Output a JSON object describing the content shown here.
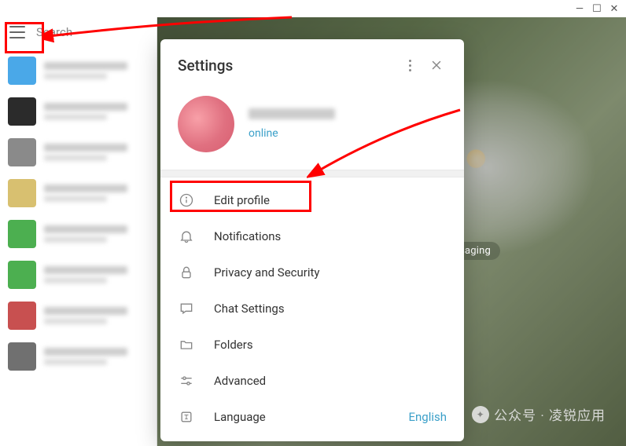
{
  "window": {
    "minimize": "—",
    "maximize": "☐",
    "close": "✕"
  },
  "sidebar": {
    "search_placeholder": "Search",
    "chats": [
      {
        "avatar_color": "#4aa8e8"
      },
      {
        "avatar_color": "#2b2b2b"
      },
      {
        "avatar_color": "#8a8a8a"
      },
      {
        "avatar_color": "#d8c070"
      },
      {
        "avatar_color": "#4caf50"
      },
      {
        "avatar_color": "#4caf50"
      },
      {
        "avatar_color": "#c85050"
      },
      {
        "avatar_color": "#707070"
      }
    ]
  },
  "main": {
    "hint": "ssaging"
  },
  "settings": {
    "title": "Settings",
    "profile": {
      "status": "online"
    },
    "items": [
      {
        "key": "edit-profile",
        "icon": "info",
        "label": "Edit profile"
      },
      {
        "key": "notifications",
        "icon": "bell",
        "label": "Notifications"
      },
      {
        "key": "privacy",
        "icon": "lock",
        "label": "Privacy and Security"
      },
      {
        "key": "chat",
        "icon": "chat",
        "label": "Chat Settings"
      },
      {
        "key": "folders",
        "icon": "folder",
        "label": "Folders"
      },
      {
        "key": "advanced",
        "icon": "sliders",
        "label": "Advanced"
      },
      {
        "key": "language",
        "icon": "language",
        "label": "Language",
        "value": "English"
      }
    ]
  },
  "watermark": "公众号 · 凌锐应用"
}
